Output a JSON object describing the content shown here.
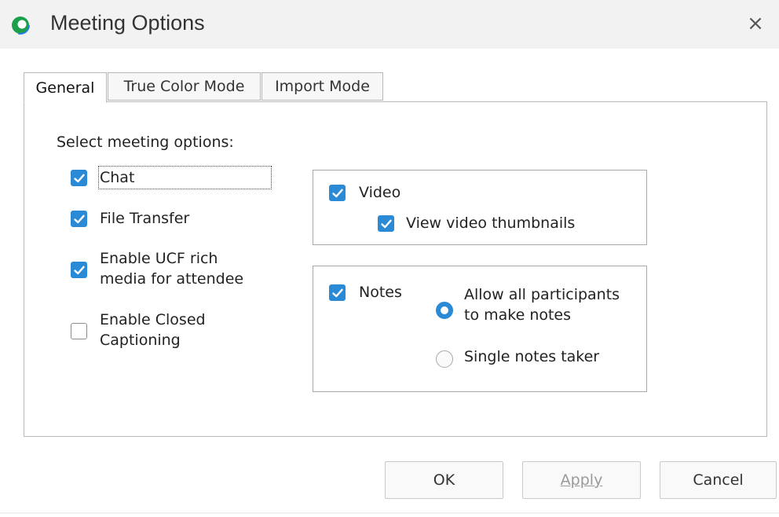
{
  "window": {
    "title": "Meeting Options",
    "close_glyph": "×"
  },
  "icons": {
    "app": "webex-icon",
    "close": "close-icon",
    "check": "check-icon"
  },
  "colors": {
    "accent": "#2b8ad6"
  },
  "tabs": [
    {
      "label": "General",
      "active": true
    },
    {
      "label": "True Color Mode",
      "active": false
    },
    {
      "label": "Import Mode",
      "active": false
    }
  ],
  "general": {
    "section_label": "Select meeting options:",
    "options": {
      "chat": {
        "label": "Chat",
        "checked": true
      },
      "file_transfer": {
        "label": "File Transfer",
        "checked": true
      },
      "ucf": {
        "label_line1": "Enable UCF rich",
        "label_line2": "media for attendee",
        "checked": true
      },
      "closed_captioning": {
        "label_line1": "Enable Closed",
        "label_line2": "Captioning",
        "checked": false
      }
    },
    "video_group": {
      "video": {
        "label": "Video",
        "checked": true
      },
      "thumbnails": {
        "label": "View video thumbnails",
        "checked": true
      }
    },
    "notes_group": {
      "notes": {
        "label": "Notes",
        "checked": true
      },
      "allow_all": {
        "label_line1": "Allow all participants",
        "label_line2": "to make notes",
        "selected": true
      },
      "single_taker": {
        "label": "Single notes taker",
        "selected": false
      }
    }
  },
  "buttons": {
    "ok": "OK",
    "apply": "Apply",
    "cancel": "Cancel"
  }
}
